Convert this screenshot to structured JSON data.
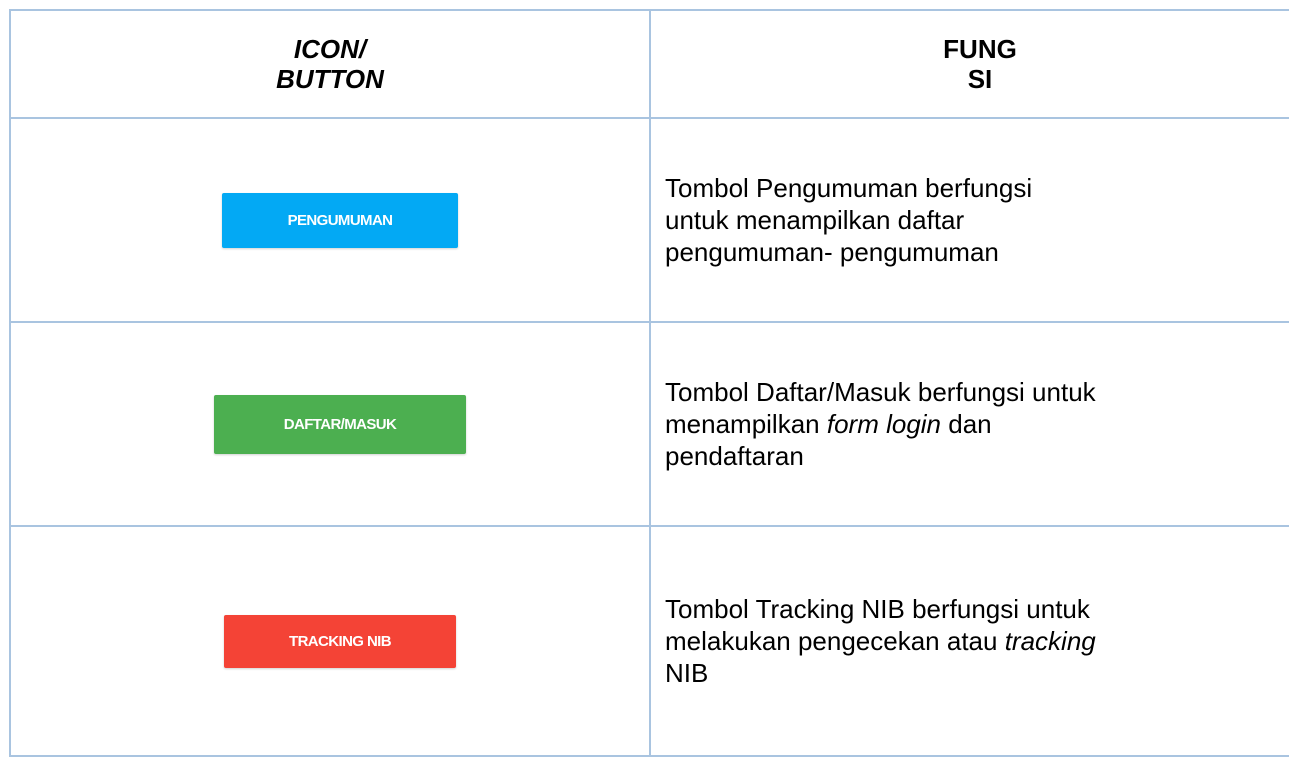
{
  "header": {
    "icon_line1": "ICON/",
    "icon_line2": "BUTTON",
    "fn_line1": "FUNG",
    "fn_line2": "SI"
  },
  "rows": [
    {
      "button_label": "PENGUMUMAN",
      "button_color": "#03a9f4",
      "desc_lines": [
        "Tombol Pengumuman berfungsi",
        "untuk menampilkan daftar",
        "pengumuman- pengumuman"
      ]
    },
    {
      "button_label": "DAFTAR/MASUK",
      "button_color": "#4caf50",
      "desc_line1": "Tombol Daftar/Masuk berfungsi untuk",
      "desc_line2_prefix": "menampilkan ",
      "desc_line2_em": "form login",
      "desc_line2_suffix": " dan",
      "desc_line3": "pendaftaran"
    },
    {
      "button_label": "TRACKING NIB",
      "button_color": "#f44336",
      "desc_line1": "Tombol Tracking NIB berfungsi untuk",
      "desc_line2_prefix": "melakukan pengecekan atau ",
      "desc_line2_em": "tracking",
      "desc_line3": "NIB"
    }
  ],
  "colors": {
    "table_border": "#a9c4e0"
  }
}
